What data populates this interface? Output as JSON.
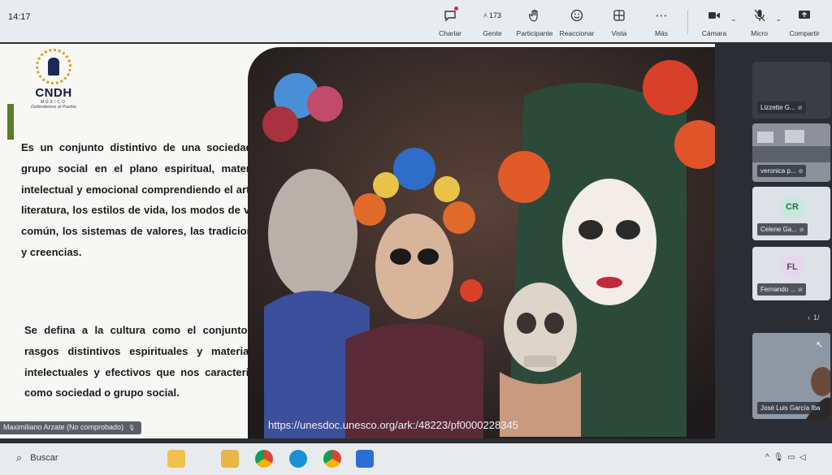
{
  "clock": "14:17",
  "toolbar": {
    "chat": "Charlar",
    "people": "Gente",
    "people_count": "173",
    "raise_hand": "Participante",
    "react": "Reaccionar",
    "view": "Vista",
    "more": "Más",
    "camera": "Cámara",
    "mic": "Micro",
    "share": "Compartir"
  },
  "slide": {
    "logo": {
      "name": "CNDH",
      "country": "MÉXICO",
      "motto": "Defendemos al Pueblo"
    },
    "paragraph1": "Es un conjunto distintivo de una sociedad o grupo social en el plano espiritual, material, intelectual y emocional comprendiendo el arte y literatura, los estilos de vida, los modos de vida común, los sistemas de valores, las tradiciones y creencias.",
    "paragraph2": "Se defina a la cultura como el conjunto de rasgos distintivos espirituales y materiales, intelectuales y efectivos que nos caracterizan como sociedad o grupo social.",
    "url": "https://unesdoc.unesco.org/ark:/48223/pf0000228345"
  },
  "presenter": "Maximiliano Arzate (No comprobado)",
  "participants": [
    {
      "name": "Lizzette G...",
      "initials": ""
    },
    {
      "name": "veronica p...",
      "initials": ""
    },
    {
      "name": "Celene Ga...",
      "initials": "CR"
    },
    {
      "name": "Fernando ...",
      "initials": "FL"
    },
    {
      "name": "José Luis García Iba",
      "initials": ""
    }
  ],
  "pager": "1/",
  "taskbar": {
    "search": "Buscar"
  },
  "colors": {
    "toolbar_bg": "#e9ecef",
    "accent_bar": "#5a7f2b",
    "notify": "#e0245e"
  }
}
